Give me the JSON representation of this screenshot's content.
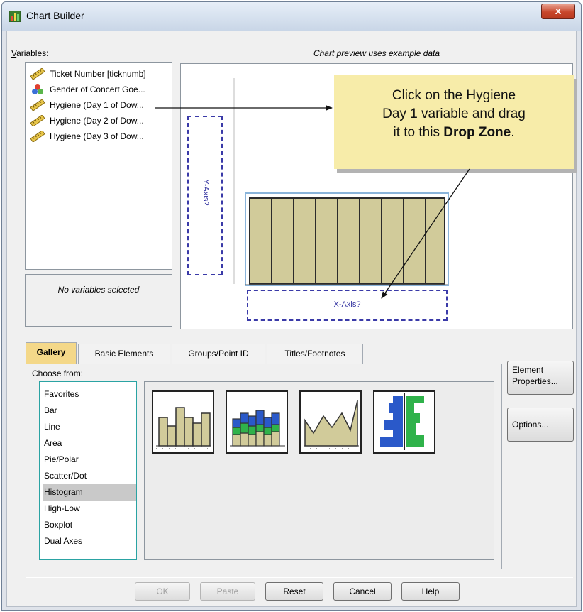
{
  "window": {
    "title": "Chart Builder",
    "close_glyph": "x"
  },
  "variables": {
    "label": "Variables:",
    "items": [
      {
        "label": "Ticket Number [ticknumb]",
        "icon": "ruler-scale-icon"
      },
      {
        "label": "Gender of Concert Goe...",
        "icon": "nominal-circles-icon"
      },
      {
        "label": "Hygiene (Day 1 of Dow...",
        "icon": "ruler-scale-icon"
      },
      {
        "label": "Hygiene (Day 2 of Dow...",
        "icon": "ruler-scale-icon"
      },
      {
        "label": "Hygiene (Day 3 of Dow...",
        "icon": "ruler-scale-icon"
      }
    ],
    "info_text": "No variables selected"
  },
  "preview": {
    "caption": "Chart preview uses example data",
    "y_axis_label": "Y-Axis?",
    "x_axis_label": "X-Axis?"
  },
  "callout": {
    "line1": "Click on the Hygiene",
    "line2": "Day 1 variable and drag",
    "line3_prefix": "it to this ",
    "line3_bold": "Drop Zone",
    "line3_suffix": "."
  },
  "tabs": [
    {
      "label": "Gallery",
      "active": true
    },
    {
      "label": "Basic Elements",
      "active": false
    },
    {
      "label": "Groups/Point ID",
      "active": false
    },
    {
      "label": "Titles/Footnotes",
      "active": false
    }
  ],
  "gallery": {
    "choose_label": "Choose from:",
    "items": [
      "Favorites",
      "Bar",
      "Line",
      "Area",
      "Pie/Polar",
      "Scatter/Dot",
      "Histogram",
      "High-Low",
      "Boxplot",
      "Dual Axes"
    ],
    "selected": "Histogram",
    "thumbnails": [
      "simple-histogram-icon",
      "stacked-histogram-icon",
      "frequency-polygon-icon",
      "population-pyramid-icon"
    ]
  },
  "side_buttons": {
    "element_properties_line1": "Element",
    "element_properties_line2": "Properties...",
    "options": "Options..."
  },
  "buttons": {
    "ok": "OK",
    "paste": "Paste",
    "reset": "Reset",
    "cancel": "Cancel",
    "help": "Help"
  },
  "colors": {
    "bar_fill": "#d1cb9a",
    "drop_zone": "#3a3aa8",
    "callout_bg": "#f7eca9",
    "active_tab": "#f4d889",
    "stack_blue": "#2a59c9",
    "stack_green": "#2fb24a"
  }
}
